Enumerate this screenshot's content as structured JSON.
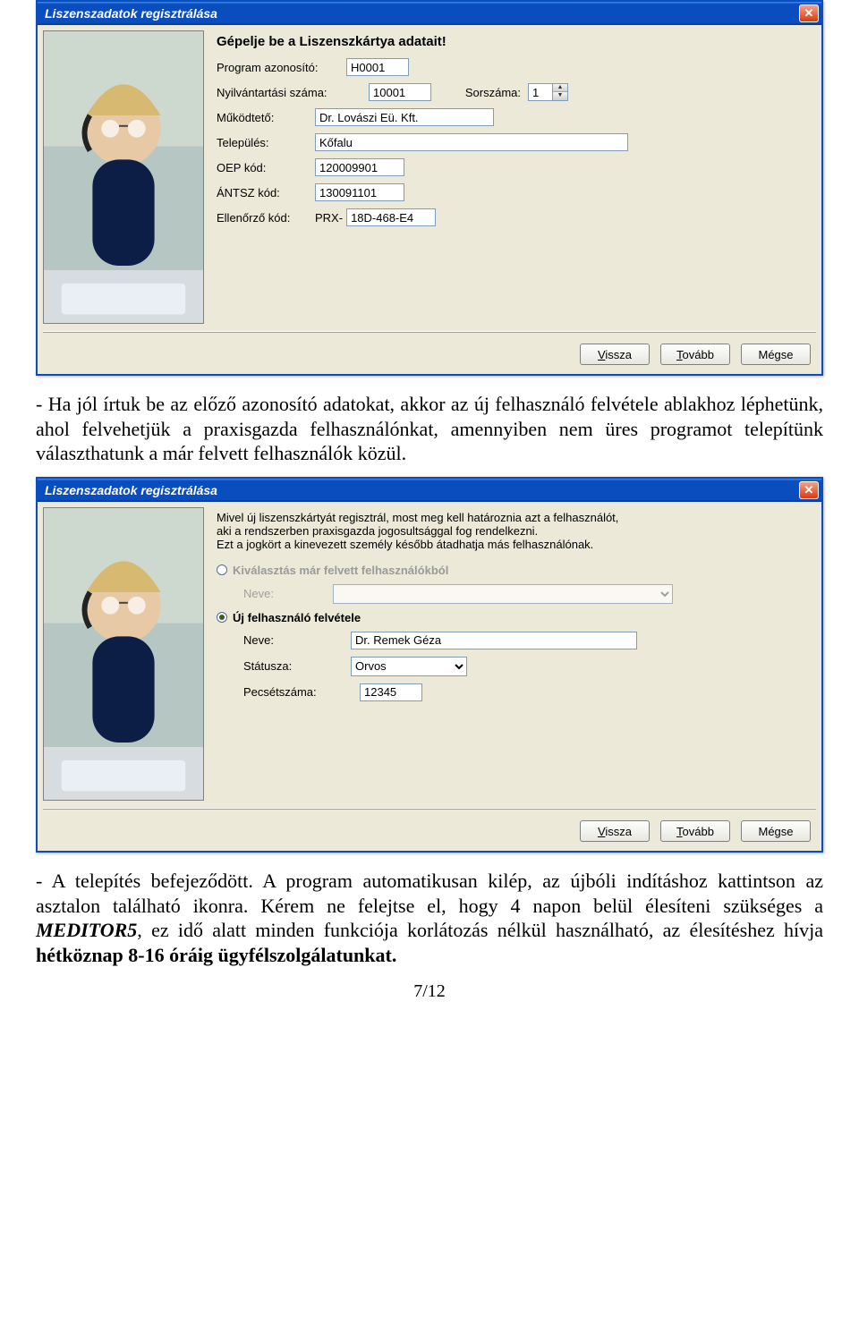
{
  "dialog1": {
    "title": "Liszenszadatok regisztrálása",
    "heading": "Gépelje be a Liszenszkártya adatait!",
    "program_id_label": "Program azonosító:",
    "program_id": "H0001",
    "reg_no_label": "Nyilvántartási száma:",
    "reg_no": "10001",
    "serial_label": "Sorszáma:",
    "serial": "1",
    "operator_label": "Működtető:",
    "operator": "Dr. Lovászi Eü. Kft.",
    "town_label": "Település:",
    "town": "Kőfalu",
    "oep_label": "OEP kód:",
    "oep": "120009901",
    "antsz_label": "ÁNTSZ kód:",
    "antsz": "130091101",
    "check_label": "Ellenőrző kód:",
    "check_prefix": "PRX-",
    "check": "18D-468-E4",
    "buttons": {
      "back": "Vissza",
      "next": "Tovább",
      "cancel": "Mégse"
    }
  },
  "paragraph1": "- Ha jól írtuk be az előző azonosító adatokat, akkor az új felhasználó felvétele ablakhoz léphetünk, ahol felvehetjük a praxisgazda felhasználónkat, amennyiben nem üres programot telepítünk választhatunk a már felvett felhasználók közül.",
  "dialog2": {
    "title": "Liszenszadatok regisztrálása",
    "intro1": "Mivel új liszenszkártyát regisztrál, most meg kell határoznia azt a felhasználót,",
    "intro2": "aki a rendszerben praxisgazda jogosultsággal fog rendelkezni.",
    "intro3": "Ezt a jogkört a kinevezett személy később átadhatja más felhasználónak.",
    "radio_existing": "Kiválasztás már felvett felhasználókból",
    "existing_name_label": "Neve:",
    "radio_new": "Új felhasználó felvétele",
    "new_name_label": "Neve:",
    "new_name": "Dr. Remek Géza",
    "status_label": "Státusza:",
    "status": "Orvos",
    "stamp_label": "Pecsétszáma:",
    "stamp": "12345",
    "buttons": {
      "back": "Vissza",
      "next": "Tovább",
      "cancel": "Mégse"
    }
  },
  "paragraph2_pre": "- A telepítés befejeződött. A program automatikusan kilép, az újbóli indításhoz kattintson az asztalon található ikonra. Kérem ne felejtse el, hogy 4 napon belül élesíteni szükséges a ",
  "paragraph2_product": "MEDITOR5",
  "paragraph2_mid": ", ez idő alatt minden funkciója korlátozás nélkül használható, az élesítéshez hívja ",
  "paragraph2_bold": "hétköznap 8-16 óráig ügyfélszolgálatunkat.",
  "page_number": "7/12"
}
